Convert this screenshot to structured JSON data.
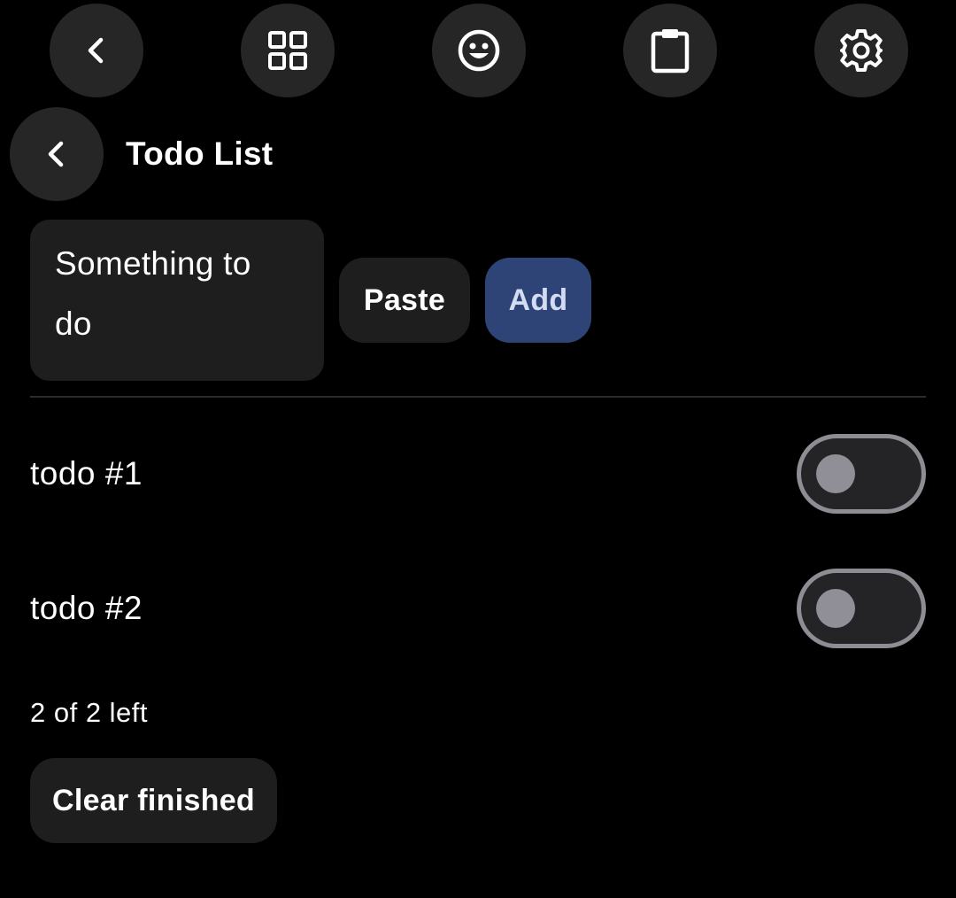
{
  "toolbar": {
    "icons": [
      "chevron-left-icon",
      "grid-icon",
      "smiley-icon",
      "clipboard-icon",
      "gear-icon"
    ]
  },
  "header": {
    "back_icon": "chevron-left-icon",
    "title": "Todo List"
  },
  "new_todo": {
    "value": "Something to do",
    "value_line1": "Something to",
    "value_line2": "do",
    "paste_label": "Paste",
    "add_label": "Add"
  },
  "todos": [
    {
      "label": "todo #1",
      "done": false
    },
    {
      "label": "todo #2",
      "done": false
    }
  ],
  "footer": {
    "remaining": "2 of 2 left",
    "clear_label": "Clear finished"
  },
  "colors": {
    "background": "#000000",
    "surface": "#1e1e1e",
    "circle_button": "#262626",
    "accent": "#2f4476",
    "accent_text": "#d4dcf4",
    "toggle_outline": "#8f8d94"
  }
}
